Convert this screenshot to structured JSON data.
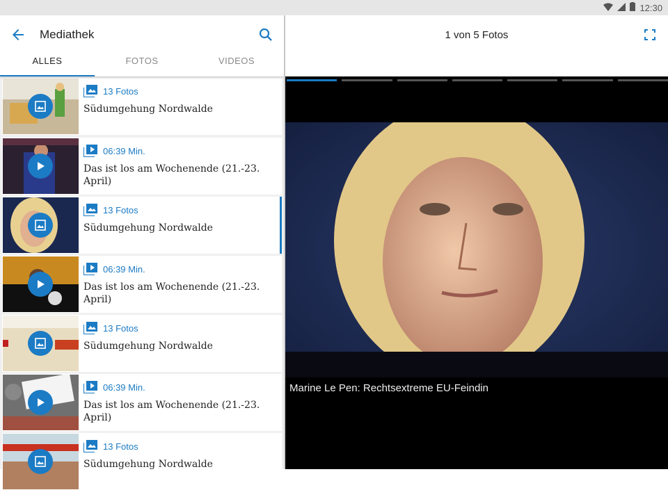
{
  "status": {
    "time": "12:30"
  },
  "header": {
    "title": "Mediathek",
    "back_icon": "arrow-left-icon",
    "search_icon": "search-icon"
  },
  "tabs": [
    {
      "label": "ALLES",
      "active": true
    },
    {
      "label": "FOTOS",
      "active": false
    },
    {
      "label": "VIDEOS",
      "active": false
    }
  ],
  "items": [
    {
      "type": "photos",
      "meta": "13 Fotos",
      "title": "Südumgehung Nordwalde"
    },
    {
      "type": "video",
      "meta": "06:39 Min.",
      "title": "Das ist los am Wochenende (21.-23. April)"
    },
    {
      "type": "photos",
      "meta": "13 Fotos",
      "title": "Südumgehung Nordwalde",
      "selected": true
    },
    {
      "type": "video",
      "meta": "06:39 Min.",
      "title": "Das ist los am Wochenende (21.-23. April)"
    },
    {
      "type": "photos",
      "meta": "13 Fotos",
      "title": "Südumgehung Nordwalde"
    },
    {
      "type": "video",
      "meta": "06:39 Min.",
      "title": "Das ist los am Wochenende (21.-23. April)"
    },
    {
      "type": "photos",
      "meta": "13 Fotos",
      "title": "Südumgehung Nordwalde"
    }
  ],
  "viewer": {
    "counter": "1 von 5 Fotos",
    "caption": "Marine Le Pen: Rechtsextreme EU-Feindin",
    "total_segments": 7,
    "active_segment": 0
  },
  "colors": {
    "accent": "#1b7bc4"
  }
}
